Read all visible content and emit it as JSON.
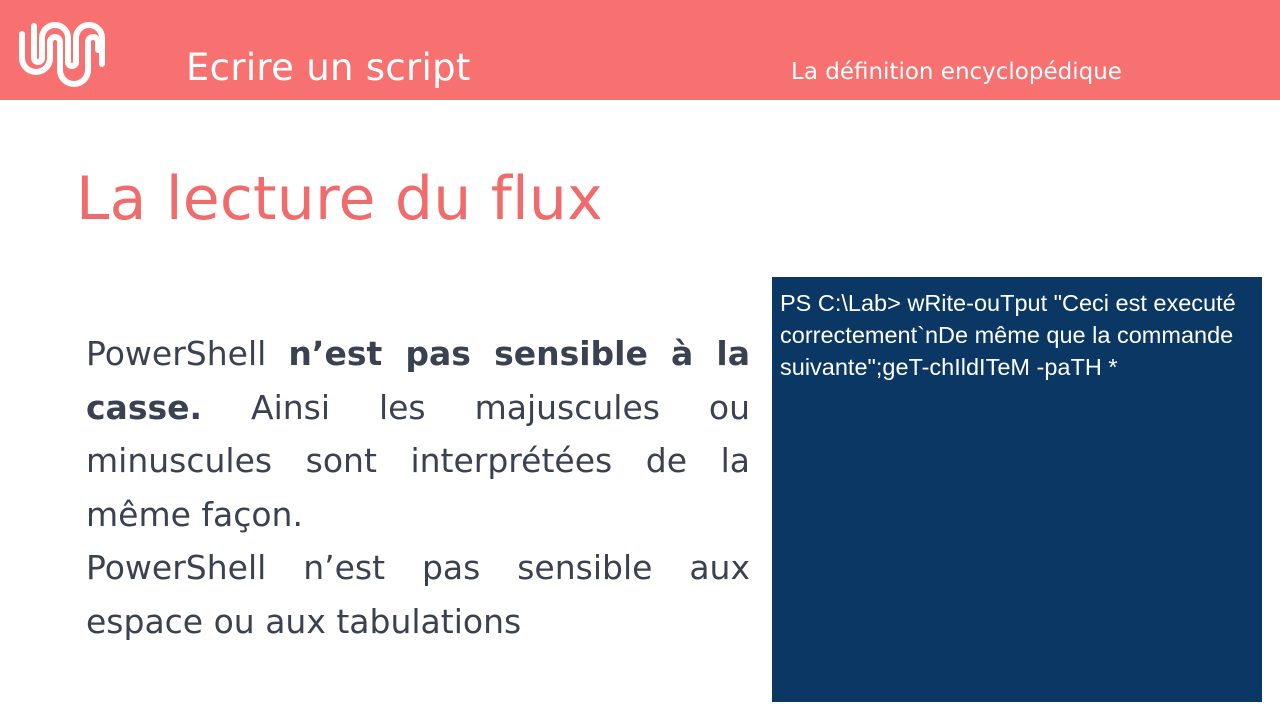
{
  "header": {
    "title": "Ecrire un script",
    "subtitle": "La définition encyclopédique",
    "logo_icon": "wave-logo-icon",
    "background_color": "#f87171"
  },
  "slide": {
    "title": "La lecture du flux",
    "title_color": "#f06b6b",
    "paragraph1": {
      "prefix": "PowerShell ",
      "bold": "n’est pas sensible à la casse.",
      "suffix": " Ainsi les majuscules ou minuscules sont interprétées de la même façon."
    },
    "paragraph2": "PowerShell n’est pas sensible aux espace ou aux tabulations"
  },
  "console": {
    "text": "PS C:\\Lab> wRite-ouTput \"Ceci est executé correctement`nDe même que la commande suivante\";geT-chIldITeM -paTH *",
    "background_color": "#0b3764"
  }
}
